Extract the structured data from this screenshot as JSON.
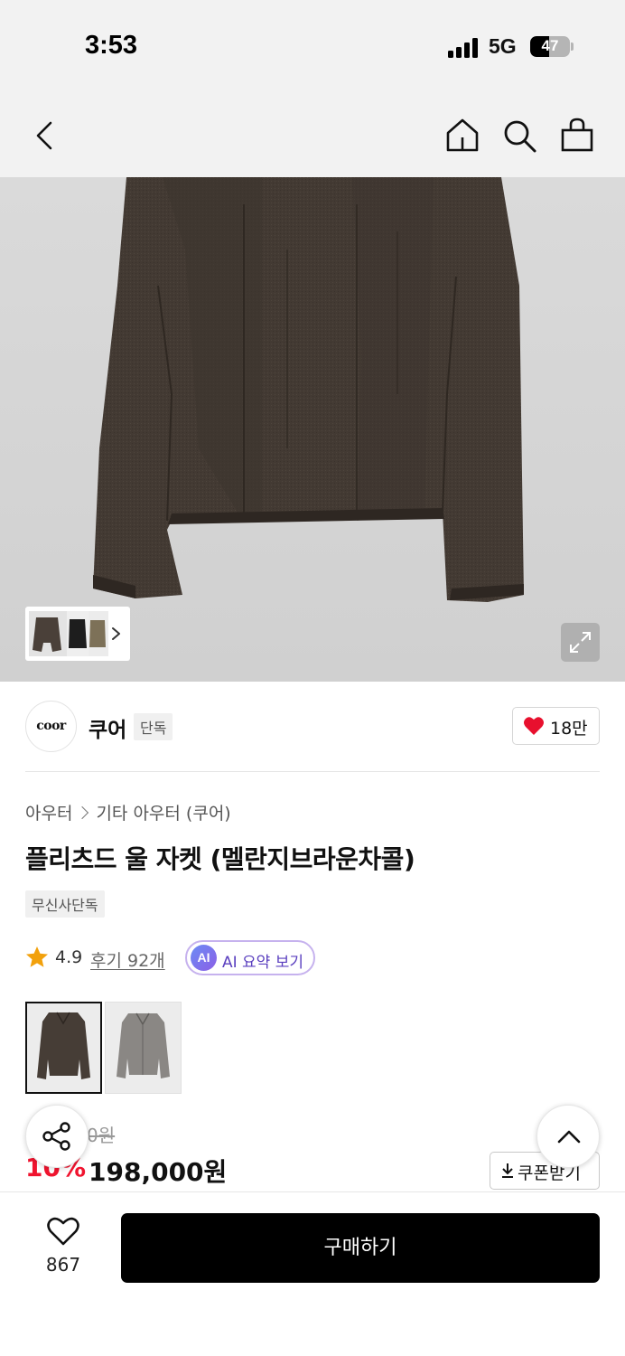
{
  "status_bar": {
    "time": "3:53",
    "network": "5G",
    "battery": "47",
    "battery_level": 0.47
  },
  "nav": {
    "back_icon": "chevron-left-icon",
    "home_icon": "home-icon",
    "search_icon": "search-icon",
    "cart_icon": "shopping-bag-icon"
  },
  "gallery": {
    "image_subject": "dark brown pleated wool jacket",
    "expand_icon": "expand-icon",
    "thumbnail_chevron_icon": "chevron-right-icon"
  },
  "brand": {
    "logo_text": "coor",
    "name": "쿠어",
    "badge": "단독",
    "like_count": "18만",
    "like_color": "#e8102e"
  },
  "product": {
    "breadcrumb": [
      "아우터",
      "기타 아우터 (쿠어)"
    ],
    "title": "플리츠드 울 자켓 (멜란지브라운차콜)",
    "tag": "무신사단독",
    "rating": "4.9",
    "reviews": "후기 92개",
    "ai_badge": "AI",
    "ai_summary": "AI 요약 보기",
    "colors": [
      {
        "name": "멜란지브라운차콜",
        "hex": "#433a33",
        "selected": true
      },
      {
        "name": "그레이",
        "hex": "#8a8784",
        "selected": false
      }
    ]
  },
  "price": {
    "original": "0원",
    "discount": "10%",
    "sale": "198,000원",
    "coupon_label": "쿠폰받기",
    "discount_color": "#f0142f"
  },
  "fabs": {
    "share_icon": "share-icon",
    "top_icon": "chevron-up-icon"
  },
  "bottom": {
    "wish_count": "867",
    "buy_label": "구매하기"
  }
}
